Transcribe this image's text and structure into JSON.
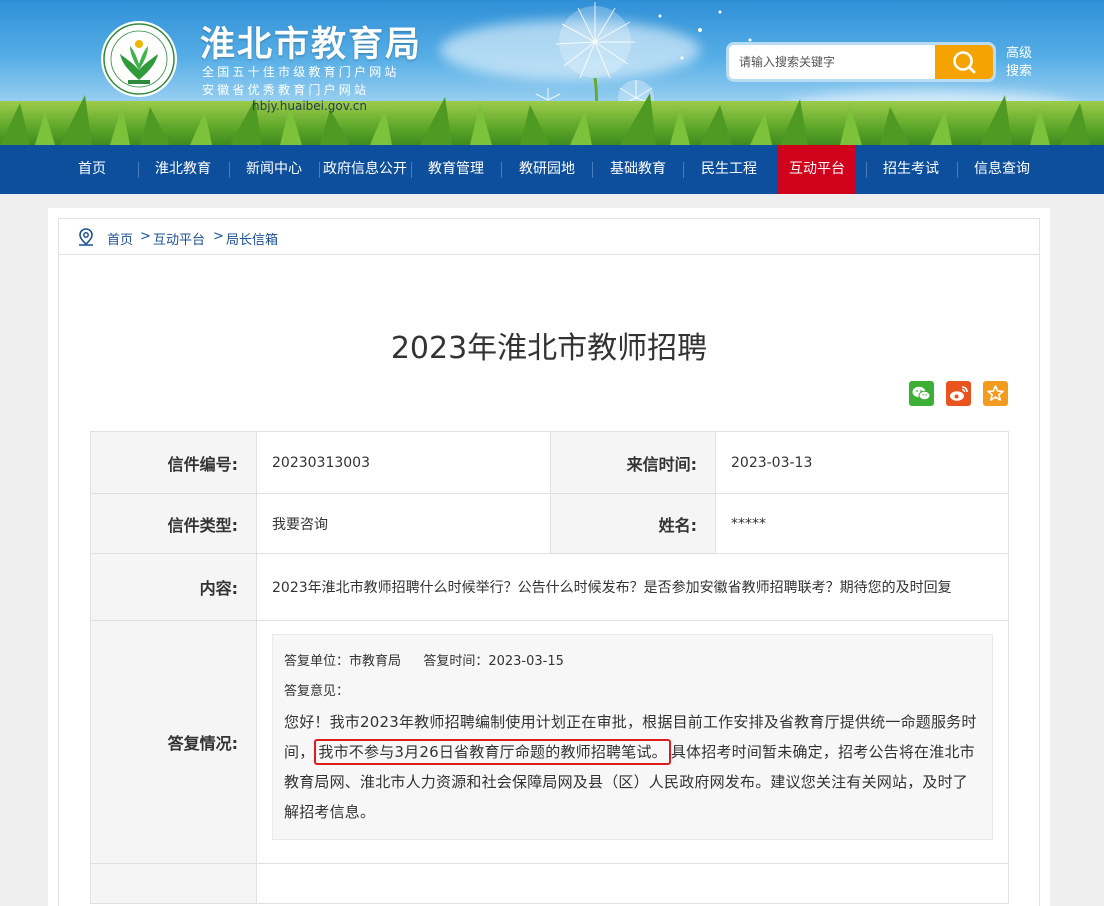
{
  "header": {
    "title": "淮北市教育局",
    "subtitle_line1": "全国五十佳市级教育门户网站",
    "subtitle_line2": "安徽省优秀教育门户网站",
    "url": "hbjy.huaibei.gov.cn",
    "search_placeholder": "请输入搜索关键字",
    "advanced_search_label": "高级搜索"
  },
  "nav": {
    "items": [
      "首页",
      "淮北教育",
      "新闻中心",
      "政府信息公开",
      "教育管理",
      "教研园地",
      "基础教育",
      "民生工程",
      "互动平台",
      "招生考试",
      "信息查询"
    ],
    "active": "互动平台"
  },
  "breadcrumb": {
    "items": [
      "首页",
      "互动平台",
      "局长信箱"
    ],
    "separator": ">"
  },
  "page_title": "2023年淮北市教师招聘",
  "share_icons": [
    "wechat-icon",
    "weibo-icon",
    "favorite-star-icon"
  ],
  "colors": {
    "nav_bg": "#0d4f9c",
    "nav_active": "#d0021b",
    "search_button": "#f5a300",
    "highlight_border": "#e01b1b",
    "link": "#1b4f95"
  },
  "letter": {
    "number_label": "信件编号:",
    "number": "20230313003",
    "date_label": "来信时间:",
    "date": "2023-03-13",
    "type_label": "信件类型:",
    "type": "我要咨询",
    "name_label": "姓名:",
    "name": "*****",
    "content_label": "内容:",
    "content": "2023年淮北市教师招聘什么时候举行？公告什么时候发布？是否参加安徽省教师招聘联考？期待您的及时回复",
    "reply_label": "答复情况:"
  },
  "reply": {
    "unit_label": "答复单位：",
    "unit": "市教育局",
    "time_label": "答复时间：",
    "time": "2023-03-15",
    "opinion_label": "答复意见：",
    "text_before": "您好！我市2023年教师招聘编制使用计划正在审批，根据目前工作安排及省教育厅提供统一命题服务时间，",
    "text_highlight": "我市不参与3月26日省教育厅命题的教师招聘笔试。",
    "text_after": "具体招考时间暂未确定，招考公告将在淮北市教育局网、淮北市人力资源和社会保障局网及县（区）人民政府网发布。建议您关注有关网站，及时了解招考信息。"
  }
}
